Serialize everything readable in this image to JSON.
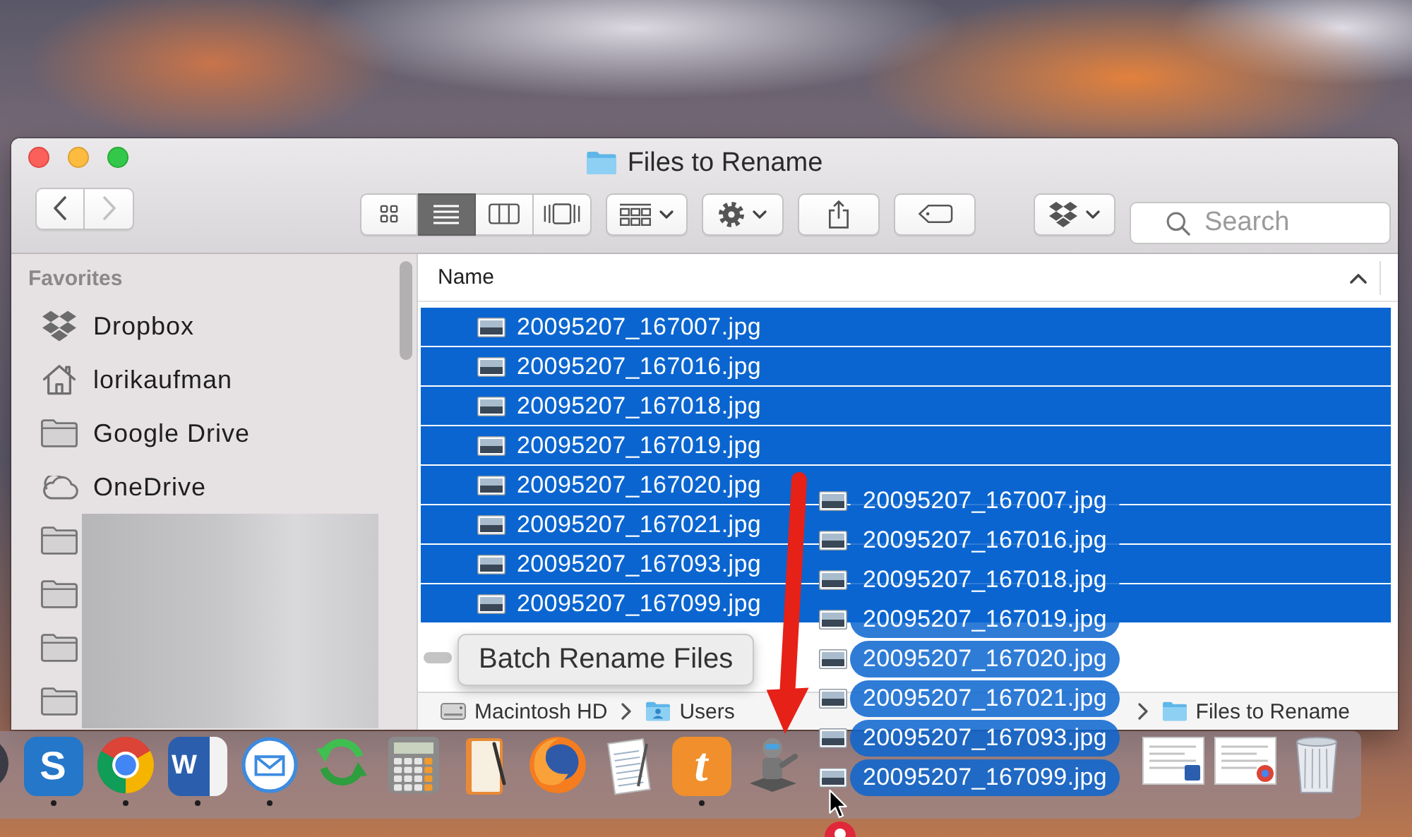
{
  "window": {
    "title": "Files to Rename"
  },
  "toolbar": {
    "navigation": [
      {
        "kind": "back",
        "disabled": false
      },
      {
        "kind": "forward",
        "disabled": true
      }
    ],
    "view_modes": [
      {
        "kind": "icons",
        "selected": false
      },
      {
        "kind": "list",
        "selected": true
      },
      {
        "kind": "columns",
        "selected": false
      },
      {
        "kind": "gallery",
        "selected": false
      }
    ],
    "buttons": [
      {
        "kind": "arrange",
        "has_menu": true
      },
      {
        "kind": "action",
        "has_menu": true
      },
      {
        "kind": "share",
        "has_menu": false
      },
      {
        "kind": "tag",
        "has_menu": false
      },
      {
        "kind": "dropbox",
        "has_menu": true
      }
    ],
    "search": {
      "placeholder": "Search"
    }
  },
  "sidebar": {
    "heading": "Favorites",
    "items": [
      {
        "kind": "dropbox",
        "label": "Dropbox"
      },
      {
        "kind": "home",
        "label": "lorikaufman"
      },
      {
        "kind": "folder",
        "label": "Google Drive"
      },
      {
        "kind": "cloud",
        "label": "OneDrive"
      },
      {
        "kind": "folder",
        "blurred": true
      },
      {
        "kind": "folder",
        "blurred": true
      },
      {
        "kind": "folder",
        "blurred": true
      },
      {
        "kind": "folder",
        "blurred": true
      }
    ]
  },
  "file_list": {
    "columns": [
      {
        "label": "Name",
        "ascending": true
      }
    ],
    "rows": [
      {
        "name": "20095207_167007.jpg",
        "selected": true
      },
      {
        "name": "20095207_167016.jpg",
        "selected": true
      },
      {
        "name": "20095207_167018.jpg",
        "selected": true
      },
      {
        "name": "20095207_167019.jpg",
        "selected": true
      },
      {
        "name": "20095207_167020.jpg",
        "selected": true
      },
      {
        "name": "20095207_167021.jpg",
        "selected": true
      },
      {
        "name": "20095207_167093.jpg",
        "selected": true
      },
      {
        "name": "20095207_167099.jpg",
        "selected": true
      }
    ]
  },
  "path_bar": {
    "items": [
      {
        "kind": "disk",
        "label": "Macintosh HD"
      },
      {
        "kind": "user_folder",
        "label": "Users"
      },
      {
        "kind": "folder",
        "label": "Files to Rename"
      }
    ]
  },
  "drag_preview": {
    "items": [
      {
        "name": "20095207_167007.jpg"
      },
      {
        "name": "20095207_167016.jpg"
      },
      {
        "name": "20095207_167018.jpg"
      },
      {
        "name": "20095207_167019.jpg"
      },
      {
        "name": "20095207_167020.jpg"
      },
      {
        "name": "20095207_167021.jpg"
      },
      {
        "name": "20095207_167093.jpg"
      },
      {
        "name": "20095207_167099.jpg"
      }
    ]
  },
  "tooltip": {
    "text": "Batch Rename Files"
  },
  "dock": {
    "items": [
      {
        "kind": "clipped",
        "running": false
      },
      {
        "kind": "letter_tile",
        "glyph": "S",
        "color": "#2477c9",
        "running": true
      },
      {
        "kind": "wheel",
        "running": true
      },
      {
        "kind": "document_tile",
        "glyph": "W",
        "color": "#2b5fae",
        "running": true
      },
      {
        "kind": "mail",
        "running": true
      },
      {
        "kind": "sync",
        "running": false
      },
      {
        "kind": "calculator",
        "running": false
      },
      {
        "kind": "notebook",
        "running": false
      },
      {
        "kind": "globe",
        "running": false
      },
      {
        "kind": "notepad",
        "running": false
      },
      {
        "kind": "script_tile",
        "glyph": "t",
        "color": "#f08f2b",
        "running": true
      },
      {
        "kind": "robot",
        "running": false
      },
      {
        "kind": "document",
        "running": false
      },
      {
        "kind": "webpage",
        "running": false
      },
      {
        "kind": "trash",
        "running": false
      }
    ]
  }
}
